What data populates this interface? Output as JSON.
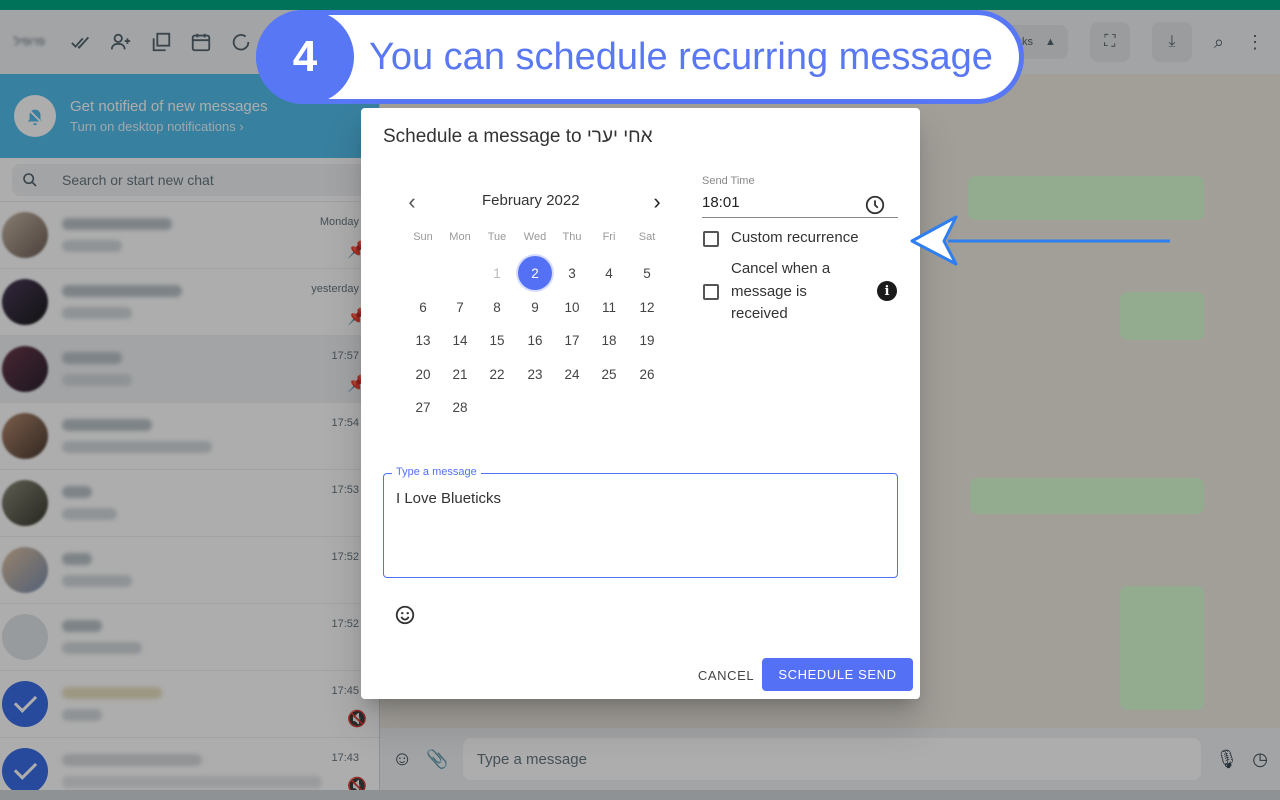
{
  "app": {
    "profile_label": "פרופיל",
    "notification": {
      "title": "Get notified of new messages",
      "subtitle": "Turn on desktop notifications ›"
    },
    "search_placeholder": "Search or start new chat",
    "chats": [
      {
        "time": "Monday",
        "pinned": true
      },
      {
        "time": "yesterday",
        "pinned": true
      },
      {
        "time": "17:57",
        "pinned": true,
        "selected": true
      },
      {
        "time": "17:54",
        "pinned": false
      },
      {
        "time": "17:53",
        "pinned": false
      },
      {
        "time": "17:52",
        "pinned": false
      },
      {
        "time": "17:52",
        "pinned": false
      },
      {
        "time": "17:45",
        "muted": true
      },
      {
        "time": "17:43",
        "muted": true
      }
    ],
    "tasks_label": "sks",
    "composer_placeholder": "Type a message",
    "colors": {
      "accent": "#00a884",
      "notification_bg": "#53bdeb",
      "bubble": "#d9fdd3"
    }
  },
  "banner": {
    "step_number": "4",
    "text": "You can schedule recurring message",
    "color": "#5777f5"
  },
  "dialog": {
    "title_prefix": "Schedule a message to ",
    "recipient": "אחי יערי",
    "calendar": {
      "month_label": "February 2022",
      "weekdays": [
        "Sun",
        "Mon",
        "Tue",
        "Wed",
        "Thu",
        "Fri",
        "Sat"
      ],
      "days": [
        "1",
        "2",
        "3",
        "4",
        "5",
        "6",
        "7",
        "8",
        "9",
        "10",
        "11",
        "12",
        "13",
        "14",
        "15",
        "16",
        "17",
        "18",
        "19",
        "20",
        "21",
        "22",
        "23",
        "24",
        "25",
        "26",
        "27",
        "28"
      ],
      "selected_day": "2",
      "disabled_days": [
        "1"
      ]
    },
    "send_time": {
      "label": "Send Time",
      "value": "18:01"
    },
    "custom_recurrence": {
      "label": "Custom recurrence",
      "checked": false
    },
    "cancel_when_received": {
      "label_lines": [
        "Cancel when a",
        "message is",
        "received"
      ],
      "checked": false
    },
    "message": {
      "legend": "Type a message",
      "value": "I Love Blueticks"
    },
    "buttons": {
      "cancel": "CANCEL",
      "schedule": "SCHEDULE SEND"
    },
    "colors": {
      "primary": "#5470f5"
    }
  }
}
